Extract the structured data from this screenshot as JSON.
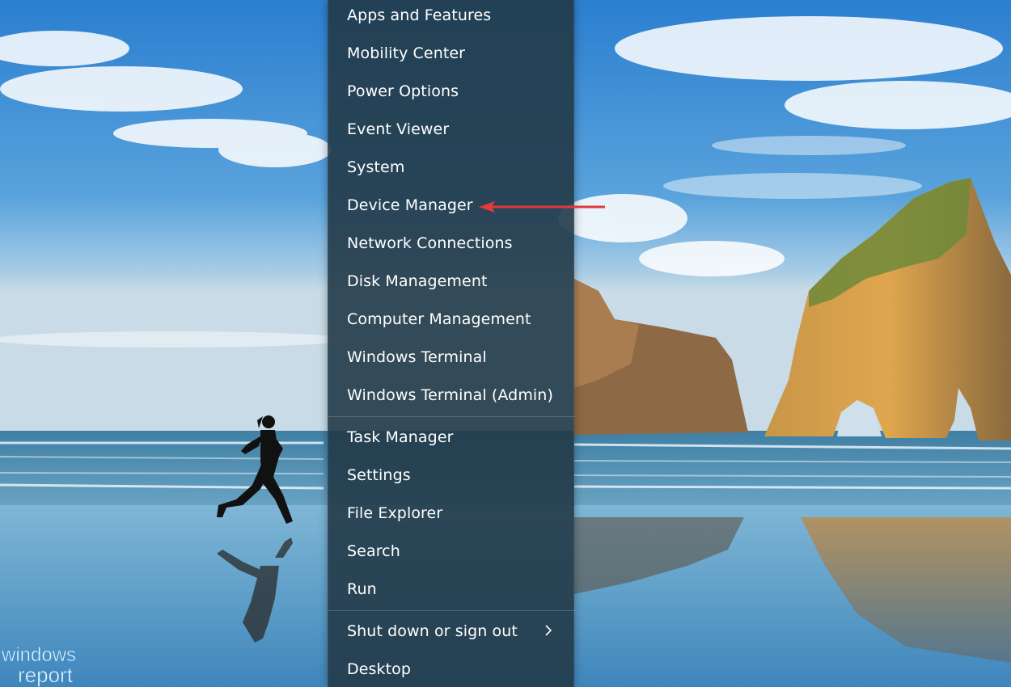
{
  "menu": {
    "groups": [
      {
        "items": [
          {
            "label": "Apps and Features"
          },
          {
            "label": "Mobility Center"
          },
          {
            "label": "Power Options"
          },
          {
            "label": "Event Viewer"
          },
          {
            "label": "System"
          },
          {
            "label": "Device Manager"
          },
          {
            "label": "Network Connections"
          },
          {
            "label": "Disk Management"
          },
          {
            "label": "Computer Management"
          },
          {
            "label": "Windows Terminal"
          },
          {
            "label": "Windows Terminal (Admin)"
          }
        ]
      },
      {
        "items": [
          {
            "label": "Task Manager"
          },
          {
            "label": "Settings"
          },
          {
            "label": "File Explorer"
          },
          {
            "label": "Search"
          },
          {
            "label": "Run"
          }
        ]
      },
      {
        "items": [
          {
            "label": "Shut down or sign out",
            "icon": "chevron-right-icon"
          },
          {
            "label": "Desktop"
          }
        ]
      }
    ]
  },
  "annotation": {
    "target": "Device Manager",
    "color": "#e03a3a"
  },
  "watermark": {
    "line1": "windows",
    "line2": "report"
  },
  "colors": {
    "menu_bg": "#223a48",
    "menu_text": "#ffffff"
  }
}
